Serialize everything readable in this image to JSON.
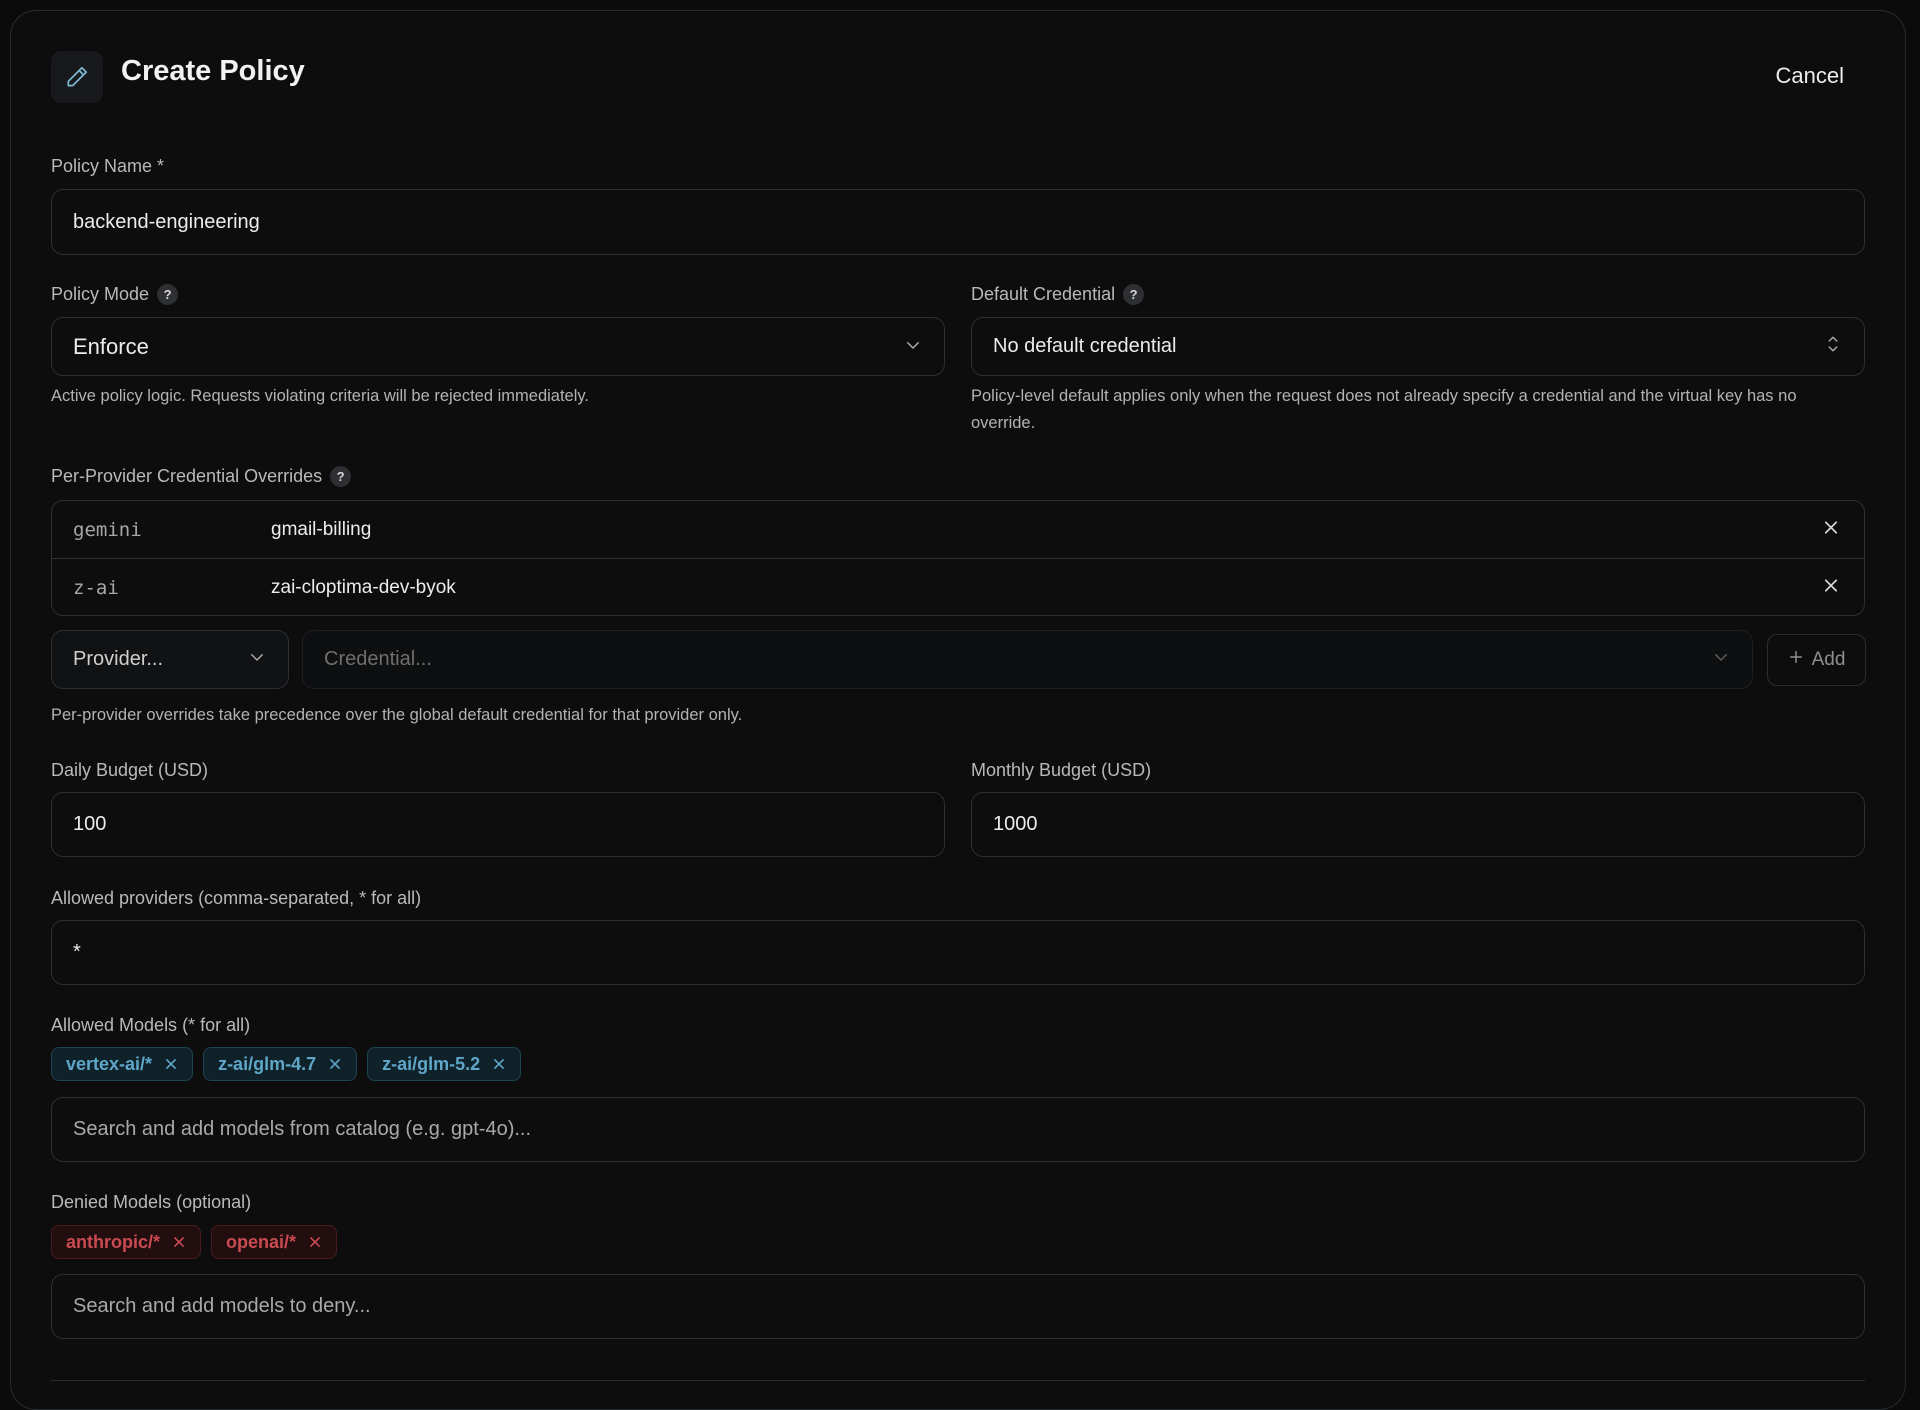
{
  "header": {
    "title": "Create Policy",
    "cancel_label": "Cancel",
    "icon": "pencil-icon"
  },
  "policy_name": {
    "label": "Policy Name *",
    "value": "backend-engineering"
  },
  "policy_mode": {
    "label": "Policy Mode",
    "value": "Enforce",
    "hint": "Active policy logic. Requests violating criteria will be rejected immediately."
  },
  "default_credential": {
    "label": "Default Credential",
    "value": "No default credential",
    "hint": "Policy-level default applies only when the request does not already specify a credential and the virtual key has no override."
  },
  "overrides": {
    "label": "Per-Provider Credential Overrides",
    "rows": [
      {
        "provider": "gemini",
        "credential": "gmail-billing"
      },
      {
        "provider": "z-ai",
        "credential": "zai-cloptima-dev-byok"
      }
    ],
    "provider_placeholder": "Provider...",
    "credential_placeholder": "Credential...",
    "add_label": "Add",
    "hint": "Per-provider overrides take precedence over the global default credential for that provider only."
  },
  "daily_budget": {
    "label": "Daily Budget (USD)",
    "value": "100"
  },
  "monthly_budget": {
    "label": "Monthly Budget (USD)",
    "value": "1000"
  },
  "allowed_providers": {
    "label": "Allowed providers (comma-separated, * for all)",
    "value": "*"
  },
  "allowed_models": {
    "label": "Allowed Models (* for all)",
    "chips": [
      "vertex-ai/*",
      "z-ai/glm-4.7",
      "z-ai/glm-5.2"
    ],
    "placeholder": "Search and add models from catalog (e.g. gpt-4o)..."
  },
  "denied_models": {
    "label": "Denied Models (optional)",
    "chips": [
      "anthropic/*",
      "openai/*"
    ],
    "placeholder": "Search and add models to deny..."
  },
  "colors": {
    "background": "#0d0d0d",
    "allowed_chip": "#5fa6c9",
    "denied_chip": "#c94b52"
  }
}
